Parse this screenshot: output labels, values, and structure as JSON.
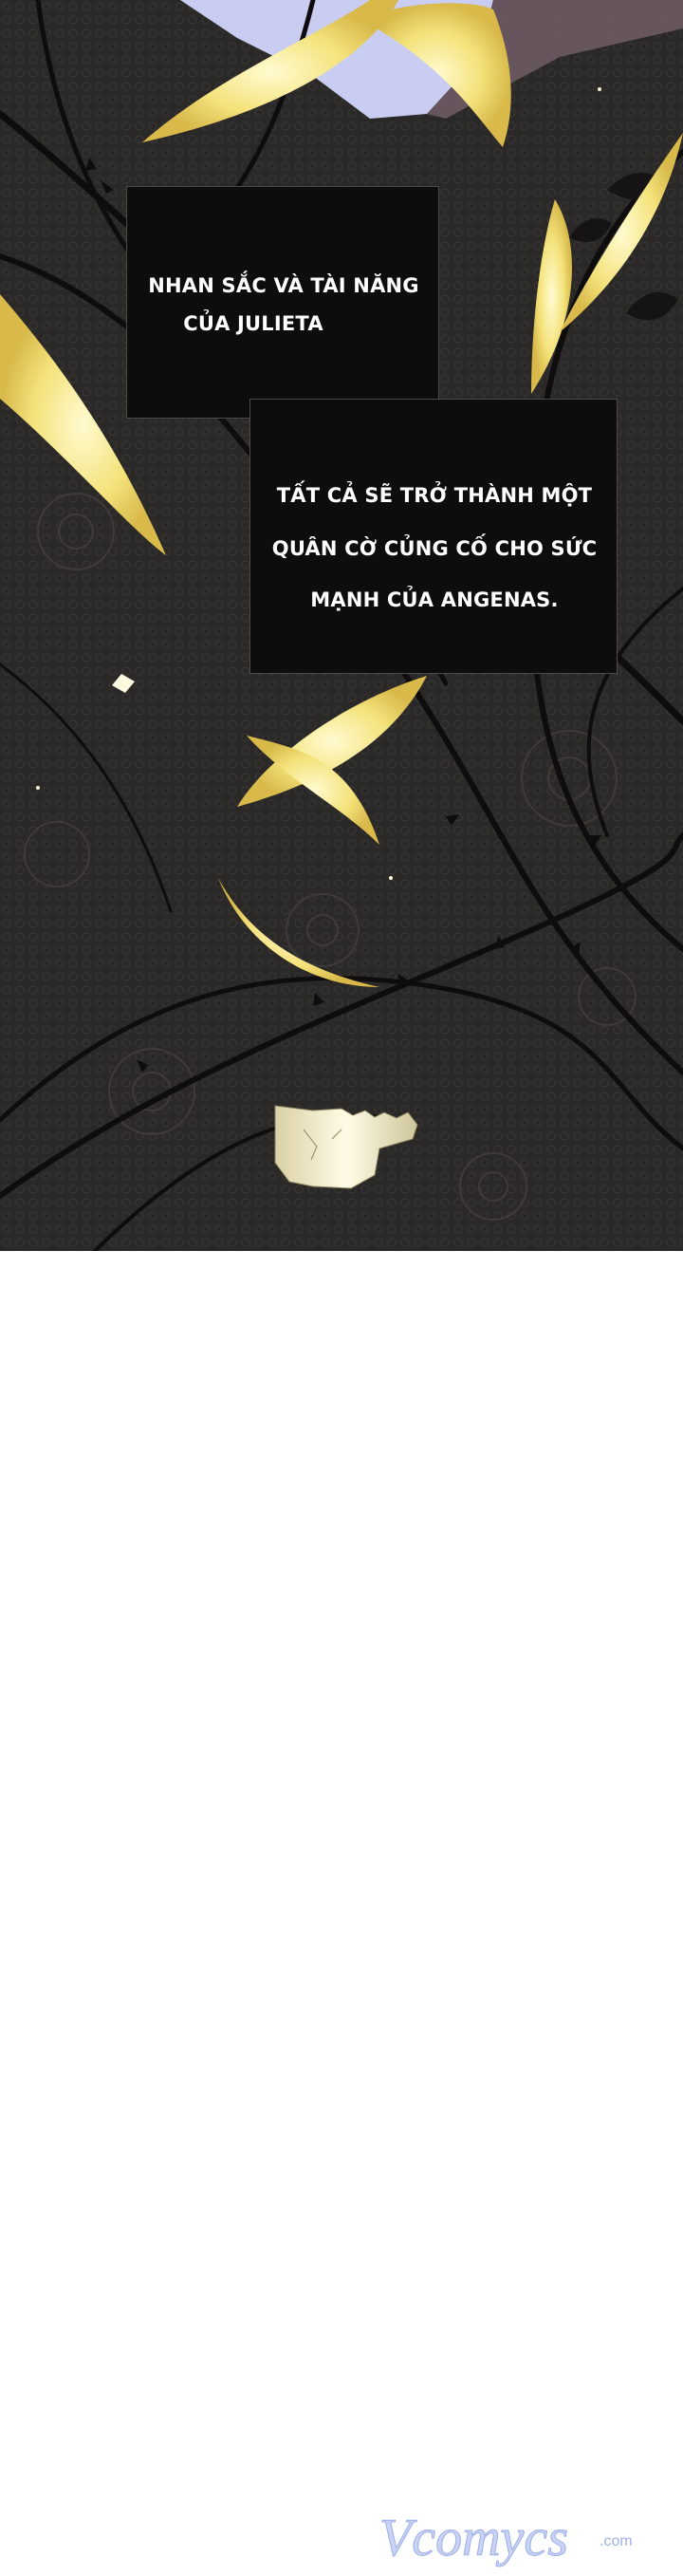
{
  "panel": {
    "caption_top": {
      "line1": "NHAN SẮC VÀ TÀI NĂNG",
      "line2": "CỦA JULIETA"
    },
    "caption_bottom": {
      "line1": "TẤT CẢ SẼ TRỞ THÀNH MỘT",
      "line2": "QUÂN CỜ CỦNG CỐ CHO SỨC",
      "line3": "MẠNH CỦA ANGENAS."
    },
    "colors": {
      "background": "#2a2827",
      "thorn": "#0e0c0c",
      "feather": "#f3e88a",
      "feather_glow": "#fff6b0",
      "sky": "#c9cdf2",
      "caption_box": "#0d0d0d"
    }
  },
  "watermark": {
    "text": "Vcomycs",
    "suffix": ".com"
  }
}
